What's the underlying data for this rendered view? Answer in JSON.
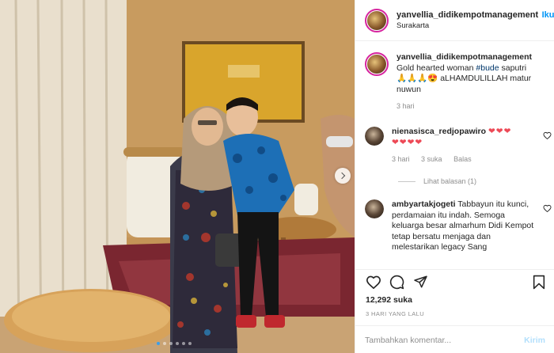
{
  "post": {
    "account": "yanvellia_didikempotmanagement",
    "follow_label": "Iku",
    "location": "Surakarta"
  },
  "caption": {
    "username": "yanvellia_didikempotmanagement",
    "text_before": "Gold hearted woman ",
    "hashtag": "#bude",
    "text_after": " saputri",
    "line2_emoji": "🙏🙏🙏😍",
    "line2_text": " aLHAMDULILLAH matur nuwun",
    "time": "3 hari"
  },
  "comments": [
    {
      "username": "nienasisca_redjopawiro",
      "text": "",
      "hearts_line1": "❤❤❤",
      "hearts_line2": "❤❤❤❤",
      "time": "3 hari",
      "likes": "3 suka",
      "reply": "Balas",
      "view_replies": "Lihat balasan (1)"
    },
    {
      "username": "ambyartakjogeti",
      "text": "Tabbayun itu kunci, perdamaian itu indah. Semoga keluarga besar almarhum Didi Kempot tetap bersatu menjaga dan melestarikan legacy Sang"
    }
  ],
  "actions": {
    "icons": [
      "heart-icon",
      "comment-icon",
      "share-icon",
      "save-icon"
    ],
    "likes": "12,292 suka",
    "date": "3 HARI YANG LALU"
  },
  "add_comment": {
    "placeholder": "Tambahkan komentar...",
    "post_label": "Kirim"
  },
  "carousel": {
    "total": 6,
    "active": 0
  },
  "colors": {
    "link": "#0095f6",
    "hashtag": "#00376b",
    "muted": "#8e8e8e",
    "heart": "#ed4956"
  }
}
